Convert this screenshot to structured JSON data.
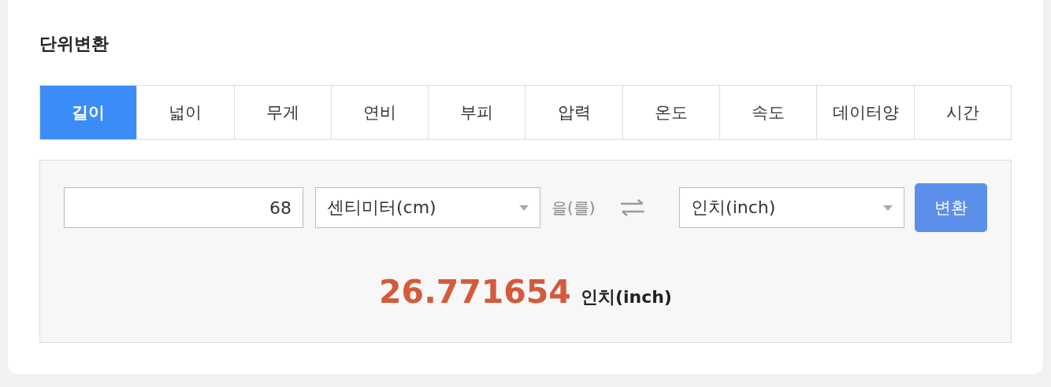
{
  "title": "단위변환",
  "tabs": [
    {
      "label": "길이",
      "selected": true
    },
    {
      "label": "넓이",
      "selected": false
    },
    {
      "label": "무게",
      "selected": false
    },
    {
      "label": "연비",
      "selected": false
    },
    {
      "label": "부피",
      "selected": false
    },
    {
      "label": "압력",
      "selected": false
    },
    {
      "label": "온도",
      "selected": false
    },
    {
      "label": "속도",
      "selected": false
    },
    {
      "label": "데이터양",
      "selected": false
    },
    {
      "label": "시간",
      "selected": false
    }
  ],
  "converter": {
    "value": "68",
    "from_unit": "센티미터(cm)",
    "particle": "을(를)",
    "to_unit": "인치(inch)",
    "button": "변환"
  },
  "result": {
    "value": "26.771654",
    "unit": "인치(inch)"
  }
}
